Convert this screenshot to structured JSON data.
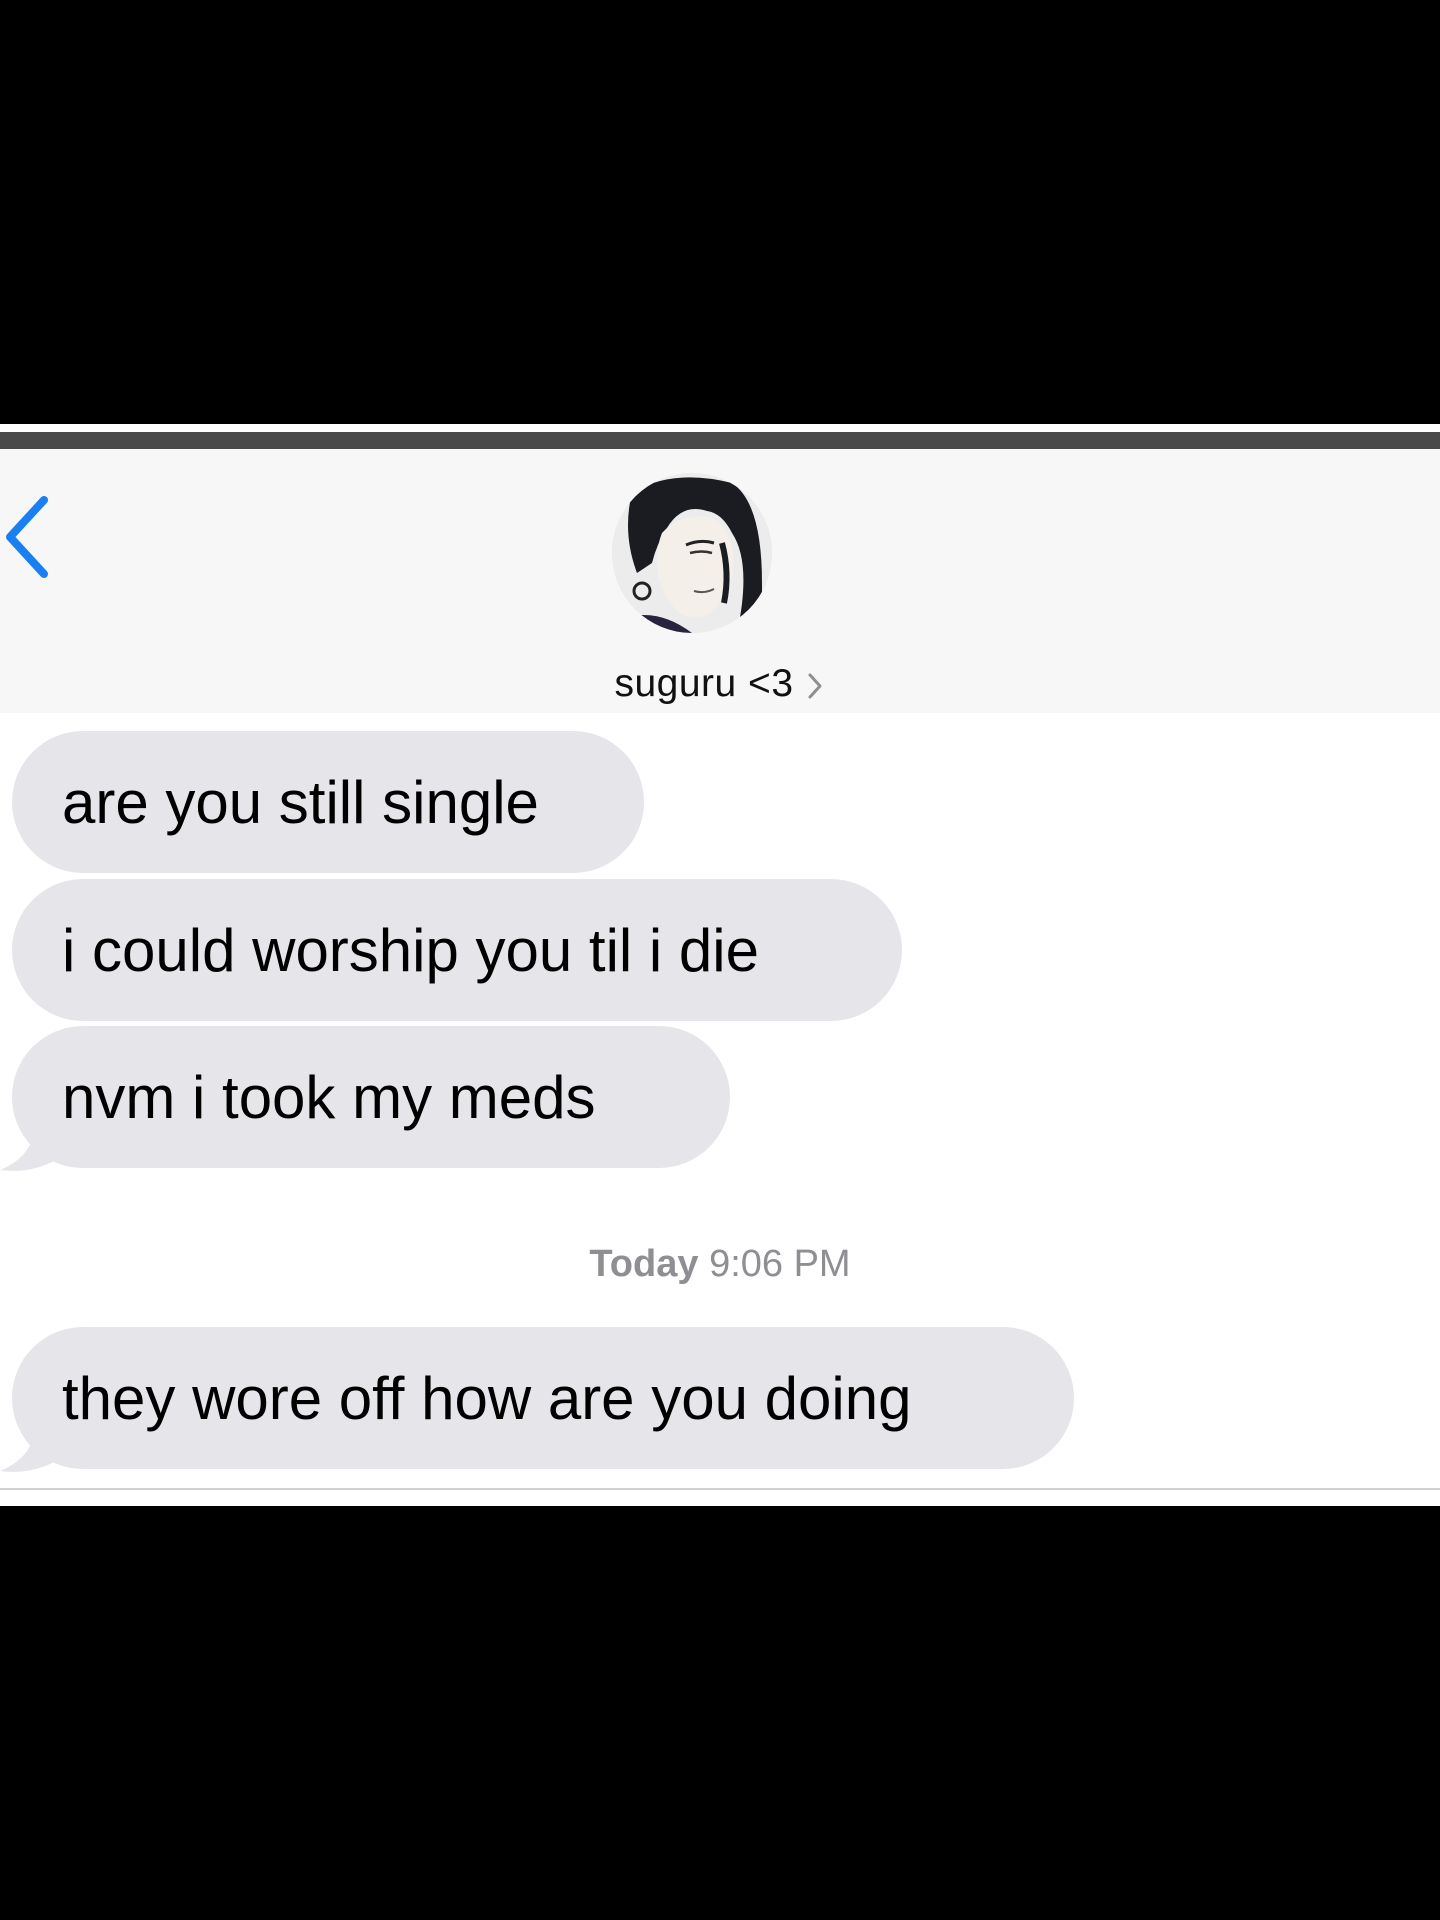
{
  "contact": {
    "name": "suguru <3",
    "avatar": "avatar-icon"
  },
  "navigation": {
    "back_icon": "chevron-left-icon",
    "details_icon": "chevron-right-icon"
  },
  "messages": [
    {
      "text": "are you still single",
      "sender": "contact"
    },
    {
      "text": "i could worship you til i die",
      "sender": "contact"
    },
    {
      "text": "nvm i took my meds",
      "sender": "contact"
    },
    {
      "text": "they wore off how are you doing",
      "sender": "contact"
    }
  ],
  "timestamp": {
    "day": "Today",
    "time": "9:06 PM"
  },
  "colors": {
    "incoming_bubble": "#e5e5ea",
    "accent": "#1a7ff0",
    "timestamp_text": "#8e8e93"
  }
}
